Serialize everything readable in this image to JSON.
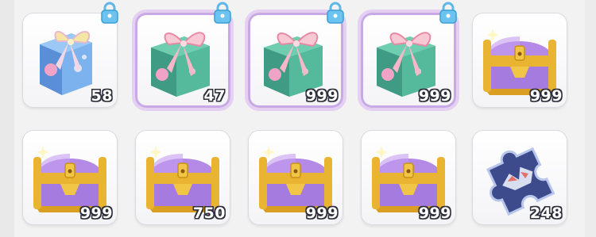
{
  "inventory": {
    "slots": [
      {
        "item": "gift-box-blue",
        "count": "58",
        "locked": true,
        "selected": false
      },
      {
        "item": "gift-box-green",
        "count": "47",
        "locked": true,
        "selected": true
      },
      {
        "item": "gift-box-green",
        "count": "999",
        "locked": true,
        "selected": true
      },
      {
        "item": "gift-box-green",
        "count": "999",
        "locked": true,
        "selected": true
      },
      {
        "item": "purple-treasure-chest",
        "count": "999",
        "locked": false,
        "selected": false
      },
      {
        "item": "purple-treasure-chest",
        "count": "999",
        "locked": false,
        "selected": false
      },
      {
        "item": "purple-treasure-chest",
        "count": "750",
        "locked": false,
        "selected": false
      },
      {
        "item": "purple-treasure-chest",
        "count": "999",
        "locked": false,
        "selected": false
      },
      {
        "item": "purple-treasure-chest",
        "count": "999",
        "locked": false,
        "selected": false
      },
      {
        "item": "puzzle-piece",
        "count": "248",
        "locked": false,
        "selected": false
      }
    ]
  },
  "colors": {
    "selected_border": "#c9a8e6",
    "lock": "#5fb8e8",
    "chest_purple": "#a67be0",
    "chest_gold": "#e8b431"
  }
}
